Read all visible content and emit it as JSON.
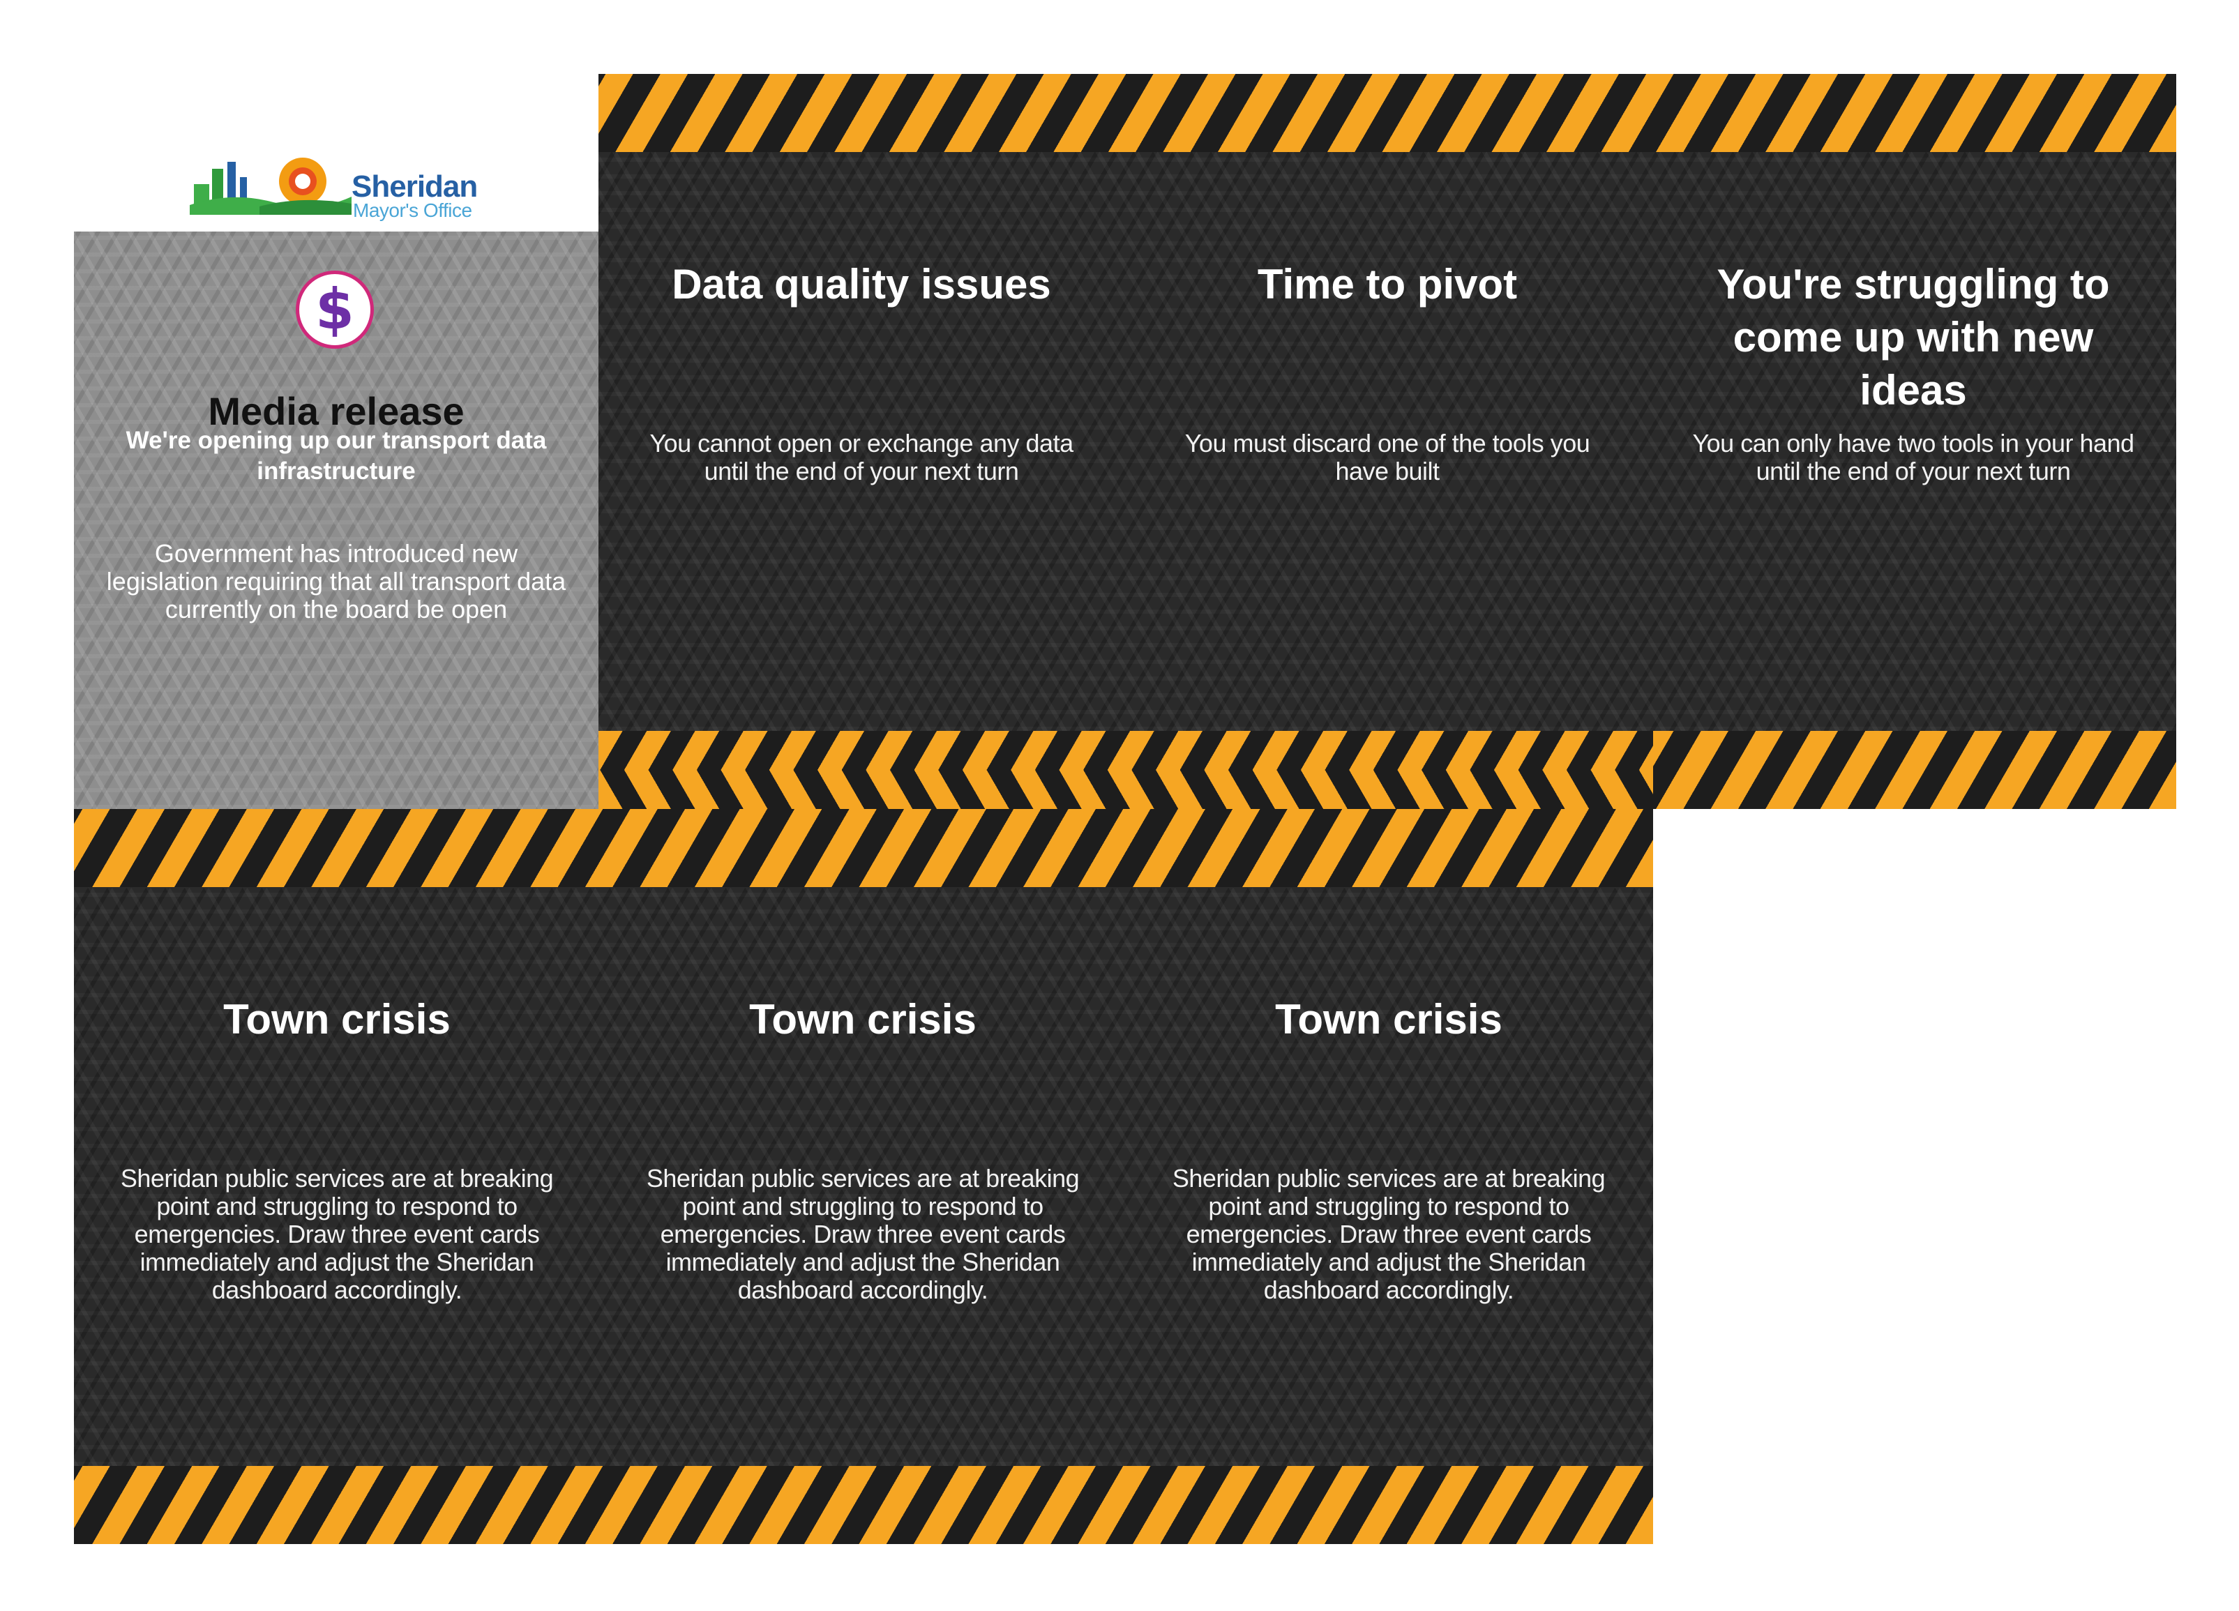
{
  "logo": {
    "name": "Sheridan",
    "subtitle": "Mayor's Office"
  },
  "media_card": {
    "icon": "dollar-icon",
    "title": "Media release",
    "subtitle": "We're opening up our transport data infrastructure",
    "body": "Government has introduced new legislation requiring that all transport data currently on the board be open"
  },
  "top_cards": [
    {
      "title": "Data quality issues",
      "body": "You cannot open or exchange any data until the end of your next turn"
    },
    {
      "title": "Time to pivot",
      "body": "You must discard one of the tools you have built"
    },
    {
      "title": "You're struggling to come up with new ideas",
      "body": "You can only have two tools in your hand until the end of your next turn"
    }
  ],
  "bottom_cards": [
    {
      "title": "Town crisis",
      "body": "Sheridan public services are at breaking point and struggling to respond to emergencies. Draw three event cards immediately and adjust the Sheridan dashboard accordingly."
    },
    {
      "title": "Town crisis",
      "body": "Sheridan public services are at breaking point and struggling to respond to emergencies. Draw three event cards immediately and adjust the Sheridan dashboard accordingly."
    },
    {
      "title": "Town crisis",
      "body": "Sheridan public services are at breaking point and struggling to respond to emergencies. Draw three event cards immediately and adjust the Sheridan dashboard accordingly."
    }
  ],
  "colors": {
    "hazard_orange": "#f6a623",
    "hazard_black": "#1d1d1d",
    "card_dark": "#2a2a2a",
    "card_grey": "#8e8e8e",
    "icon_ring": "#d0287a",
    "icon_glyph": "#6d2fa6",
    "logo_blue": "#2660a4",
    "logo_green": "#3fae49",
    "logo_orange": "#f39c12"
  }
}
